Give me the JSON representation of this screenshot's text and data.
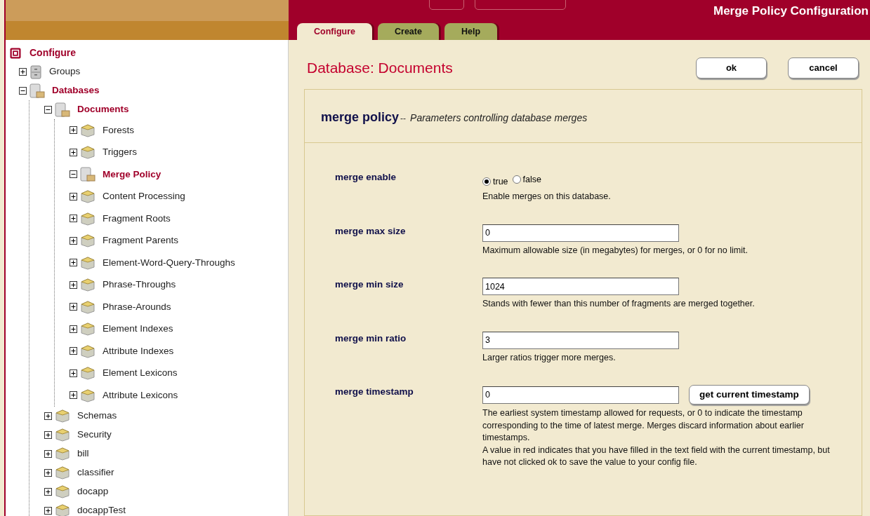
{
  "header": {
    "title": "Merge Policy Configuration"
  },
  "tabs": [
    {
      "label": "Configure",
      "selected": true
    },
    {
      "label": "Create",
      "selected": false
    },
    {
      "label": "Help",
      "selected": false
    }
  ],
  "tree": {
    "label": "Configure",
    "children": [
      {
        "label": "Groups",
        "kind": "cabinet",
        "expanded": false,
        "selected": false
      },
      {
        "label": "Databases",
        "kind": "database",
        "expanded": true,
        "selected": true,
        "children": [
          {
            "label": "Documents",
            "kind": "database",
            "expanded": true,
            "selected": true,
            "children": [
              {
                "label": "Forests",
                "kind": "box",
                "expanded": false,
                "selected": false
              },
              {
                "label": "Triggers",
                "kind": "box",
                "expanded": false,
                "selected": false
              },
              {
                "label": "Merge Policy",
                "kind": "database",
                "expanded": true,
                "selected": true
              },
              {
                "label": "Content Processing",
                "kind": "box",
                "expanded": false,
                "selected": false
              },
              {
                "label": "Fragment Roots",
                "kind": "box",
                "expanded": false,
                "selected": false
              },
              {
                "label": "Fragment Parents",
                "kind": "box",
                "expanded": false,
                "selected": false
              },
              {
                "label": "Element-Word-Query-Throughs",
                "kind": "box",
                "expanded": false,
                "selected": false
              },
              {
                "label": "Phrase-Throughs",
                "kind": "box",
                "expanded": false,
                "selected": false
              },
              {
                "label": "Phrase-Arounds",
                "kind": "box",
                "expanded": false,
                "selected": false
              },
              {
                "label": "Element Indexes",
                "kind": "box",
                "expanded": false,
                "selected": false
              },
              {
                "label": "Attribute Indexes",
                "kind": "box",
                "expanded": false,
                "selected": false
              },
              {
                "label": "Element Lexicons",
                "kind": "box",
                "expanded": false,
                "selected": false
              },
              {
                "label": "Attribute Lexicons",
                "kind": "box",
                "expanded": false,
                "selected": false
              }
            ]
          },
          {
            "label": "Schemas",
            "kind": "box",
            "expanded": false,
            "selected": false
          },
          {
            "label": "Security",
            "kind": "box",
            "expanded": false,
            "selected": false
          },
          {
            "label": "bill",
            "kind": "box",
            "expanded": false,
            "selected": false
          },
          {
            "label": "classifier",
            "kind": "box",
            "expanded": false,
            "selected": false
          },
          {
            "label": "docapp",
            "kind": "box",
            "expanded": false,
            "selected": false
          },
          {
            "label": "docappTest",
            "kind": "box",
            "expanded": false,
            "selected": false
          }
        ]
      }
    ]
  },
  "page": {
    "title": "Database: Documents",
    "buttons": [
      "ok",
      "cancel"
    ]
  },
  "section": {
    "title": "merge policy",
    "separator": "--",
    "subtitle": "Parameters controlling database merges"
  },
  "fields": [
    {
      "label": "merge enable",
      "kind": "radio",
      "options": [
        {
          "label": "true",
          "selected": true
        },
        {
          "label": "false",
          "selected": false
        }
      ],
      "description": [
        "Enable merges on this database."
      ]
    },
    {
      "label": "merge max size",
      "kind": "text",
      "value": "0",
      "description": [
        "Maximum allowable size (in megabytes) for merges, or 0 for no limit."
      ]
    },
    {
      "label": "merge min size",
      "kind": "text",
      "value": "1024",
      "description": [
        "Stands with fewer than this number of fragments are merged together."
      ]
    },
    {
      "label": "merge min ratio",
      "kind": "text",
      "value": "3",
      "description": [
        "Larger ratios trigger more merges."
      ]
    },
    {
      "label": "merge timestamp",
      "kind": "text-button",
      "value": "0",
      "button": "get current timestamp",
      "description": [
        "The earliest system timestamp allowed for requests, or 0 to indicate the timestamp corresponding to the time of latest merge. Merges discard information about earlier timestamps.",
        "A value in red indicates that you have filled in the text field with the current timestamp, but have not clicked ok to save the value to your config file."
      ]
    }
  ]
}
